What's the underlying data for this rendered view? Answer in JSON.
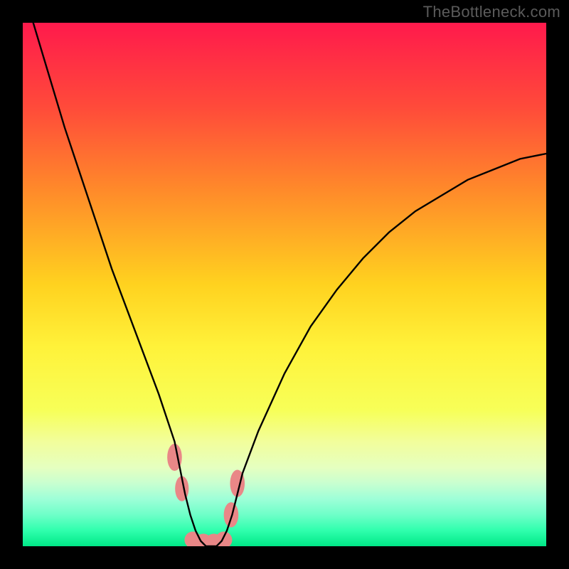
{
  "watermark": "TheBottleneck.com",
  "chart_data": {
    "type": "line",
    "title": "",
    "xlabel": "",
    "ylabel": "",
    "xlim": [
      0,
      100
    ],
    "ylim": [
      0,
      100
    ],
    "axes_visible": false,
    "background_gradient": {
      "stops": [
        {
          "pos": 0.0,
          "color": "#ff1a4c"
        },
        {
          "pos": 0.16,
          "color": "#ff4a3a"
        },
        {
          "pos": 0.32,
          "color": "#ff8a2a"
        },
        {
          "pos": 0.5,
          "color": "#ffd21f"
        },
        {
          "pos": 0.62,
          "color": "#fff23a"
        },
        {
          "pos": 0.74,
          "color": "#f7ff58"
        },
        {
          "pos": 0.8,
          "color": "#f2fe9b"
        },
        {
          "pos": 0.85,
          "color": "#e5ffc0"
        },
        {
          "pos": 0.88,
          "color": "#c8ffd0"
        },
        {
          "pos": 0.91,
          "color": "#9dffd8"
        },
        {
          "pos": 0.94,
          "color": "#6effc8"
        },
        {
          "pos": 0.97,
          "color": "#2fffad"
        },
        {
          "pos": 1.0,
          "color": "#00e887"
        }
      ]
    },
    "series": [
      {
        "name": "bottleneck-curve",
        "color": "#000000",
        "x": [
          2,
          5,
          8,
          11,
          14,
          17,
          20,
          23,
          26,
          29,
          30,
          31,
          32,
          33,
          34,
          35,
          36,
          37,
          38,
          39,
          40,
          41,
          42,
          45,
          50,
          55,
          60,
          65,
          70,
          75,
          80,
          85,
          90,
          95,
          100
        ],
        "y": [
          100,
          90,
          80,
          71,
          62,
          53,
          45,
          37,
          29,
          20,
          15,
          10,
          6,
          3,
          1,
          0,
          0,
          0,
          1,
          3,
          6,
          10,
          14,
          22,
          33,
          42,
          49,
          55,
          60,
          64,
          67,
          70,
          72,
          74,
          75
        ]
      }
    ],
    "markers": [
      {
        "name": "pink-blob-left-upper",
        "cx": 29.0,
        "cy": 17,
        "rx": 1.4,
        "ry": 2.6,
        "color": "#e98787"
      },
      {
        "name": "pink-blob-left-lower",
        "cx": 30.4,
        "cy": 11,
        "rx": 1.3,
        "ry": 2.4,
        "color": "#e98787"
      },
      {
        "name": "pink-blob-right-upper",
        "cx": 41.0,
        "cy": 12,
        "rx": 1.4,
        "ry": 2.6,
        "color": "#e98787"
      },
      {
        "name": "pink-blob-right-lower",
        "cx": 39.8,
        "cy": 6,
        "rx": 1.4,
        "ry": 2.4,
        "color": "#e98787"
      },
      {
        "name": "pink-floor-1",
        "cx": 32.5,
        "cy": 1.2,
        "rx": 1.6,
        "ry": 1.6,
        "color": "#e98787"
      },
      {
        "name": "pink-floor-2",
        "cx": 34.5,
        "cy": 0.8,
        "rx": 1.6,
        "ry": 1.6,
        "color": "#e98787"
      },
      {
        "name": "pink-floor-3",
        "cx": 36.5,
        "cy": 0.8,
        "rx": 1.6,
        "ry": 1.6,
        "color": "#e98787"
      },
      {
        "name": "pink-floor-4",
        "cx": 38.4,
        "cy": 1.2,
        "rx": 1.6,
        "ry": 1.6,
        "color": "#e98787"
      }
    ]
  }
}
